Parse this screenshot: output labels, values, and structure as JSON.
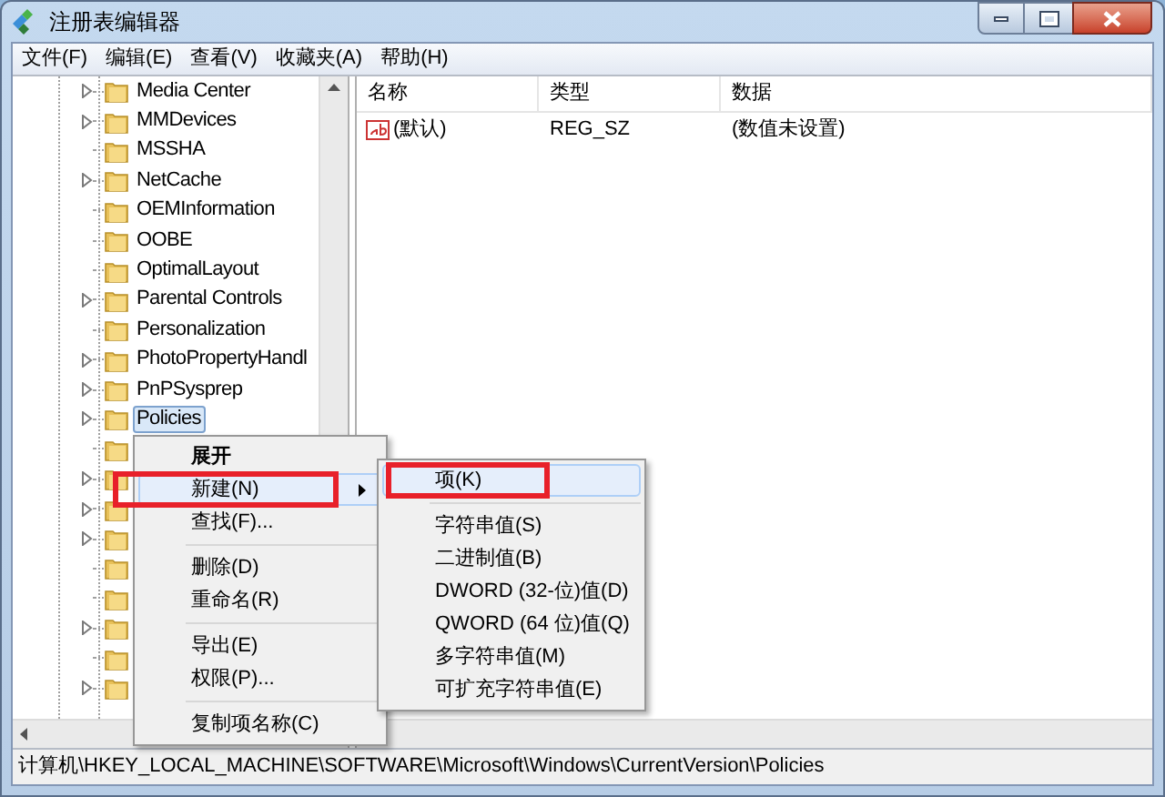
{
  "window": {
    "title": "注册表编辑器"
  },
  "menu": [
    "文件(F)",
    "编辑(E)",
    "查看(V)",
    "收藏夹(A)",
    "帮助(H)"
  ],
  "tree": [
    {
      "label": "Media Center",
      "has_children": true,
      "selected": false
    },
    {
      "label": "MMDevices",
      "has_children": true,
      "selected": false
    },
    {
      "label": "MSSHA",
      "has_children": false,
      "selected": false
    },
    {
      "label": "NetCache",
      "has_children": true,
      "selected": false
    },
    {
      "label": "OEMInformation",
      "has_children": false,
      "selected": false
    },
    {
      "label": "OOBE",
      "has_children": false,
      "selected": false
    },
    {
      "label": "OptimalLayout",
      "has_children": false,
      "selected": false
    },
    {
      "label": "Parental Controls",
      "has_children": true,
      "selected": false
    },
    {
      "label": "Personalization",
      "has_children": false,
      "selected": false
    },
    {
      "label": "PhotoPropertyHandl",
      "has_children": true,
      "selected": false
    },
    {
      "label": "PnPSysprep",
      "has_children": true,
      "selected": false
    },
    {
      "label": "Policies",
      "has_children": true,
      "selected": true
    },
    {
      "has_children": false,
      "selected": false
    },
    {
      "has_children": true,
      "selected": false
    },
    {
      "has_children": true,
      "selected": false
    },
    {
      "has_children": true,
      "selected": false
    },
    {
      "has_children": false,
      "selected": false
    },
    {
      "has_children": false,
      "selected": false
    },
    {
      "has_children": true,
      "selected": false
    },
    {
      "has_children": false,
      "selected": false
    },
    {
      "has_children": true,
      "selected": false
    }
  ],
  "values": {
    "columns": [
      "名称",
      "类型",
      "数据"
    ],
    "rows": [
      {
        "name": "(默认)",
        "type": "REG_SZ",
        "data": "(数值未设置)"
      }
    ]
  },
  "context_menu": [
    {
      "kind": "item",
      "label": "展开",
      "default": true,
      "selected": false,
      "submenu": false,
      "annotated": false
    },
    {
      "kind": "item",
      "label": "新建(N)",
      "default": false,
      "selected": true,
      "submenu": true,
      "annotated": true
    },
    {
      "kind": "item",
      "label": "查找(F)...",
      "default": false,
      "selected": false,
      "submenu": false,
      "annotated": false
    },
    {
      "kind": "separator"
    },
    {
      "kind": "item",
      "label": "删除(D)",
      "default": false,
      "selected": false,
      "submenu": false,
      "annotated": false
    },
    {
      "kind": "item",
      "label": "重命名(R)",
      "default": false,
      "selected": false,
      "submenu": false,
      "annotated": false
    },
    {
      "kind": "separator"
    },
    {
      "kind": "item",
      "label": "导出(E)",
      "default": false,
      "selected": false,
      "submenu": false,
      "annotated": false
    },
    {
      "kind": "item",
      "label": "权限(P)...",
      "default": false,
      "selected": false,
      "submenu": false,
      "annotated": false
    },
    {
      "kind": "separator"
    },
    {
      "kind": "item",
      "label": "复制项名称(C)",
      "default": false,
      "selected": false,
      "submenu": false,
      "annotated": false
    }
  ],
  "submenu": [
    {
      "kind": "item",
      "label": "项(K)",
      "selected": true,
      "annotated": true
    },
    {
      "kind": "separator"
    },
    {
      "kind": "item",
      "label": "字符串值(S)",
      "selected": false,
      "annotated": false
    },
    {
      "kind": "item",
      "label": "二进制值(B)",
      "selected": false,
      "annotated": false
    },
    {
      "kind": "item",
      "label": "DWORD (32-位)值(D)",
      "selected": false,
      "annotated": false
    },
    {
      "kind": "item",
      "label": "QWORD (64 位)值(Q)",
      "selected": false,
      "annotated": false
    },
    {
      "kind": "item",
      "label": "多字符串值(M)",
      "selected": false,
      "annotated": false
    },
    {
      "kind": "item",
      "label": "可扩充字符串值(E)",
      "selected": false,
      "annotated": false
    }
  ],
  "status_bar": "计算机\\HKEY_LOCAL_MACHINE\\SOFTWARE\\Microsoft\\Windows\\CurrentVersion\\Policies"
}
